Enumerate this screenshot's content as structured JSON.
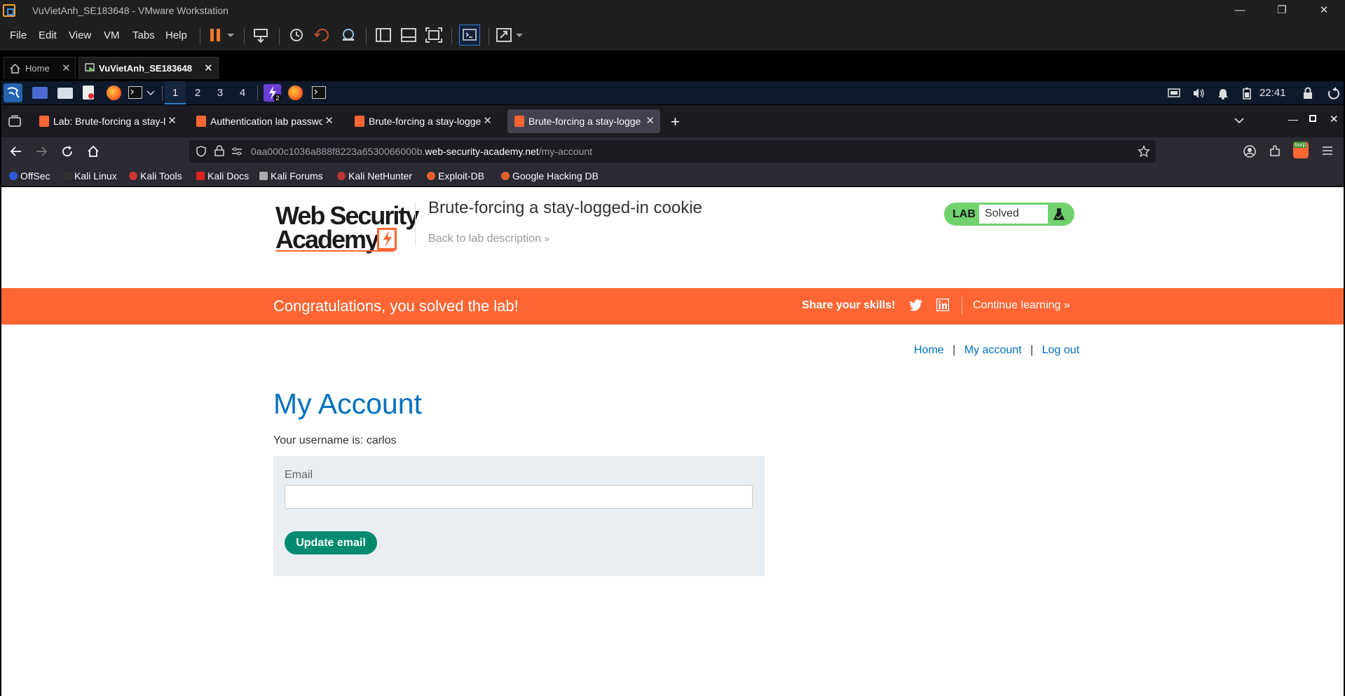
{
  "vmware": {
    "window_title": "VuVietAnh_SE183648 - VMware Workstation",
    "menu": [
      "File",
      "Edit",
      "View",
      "VM",
      "Tabs",
      "Help"
    ],
    "tabs": [
      {
        "label": "Home"
      },
      {
        "label": "VuVietAnh_SE183648"
      }
    ]
  },
  "kali_panel": {
    "workspaces": [
      "1",
      "2",
      "3",
      "4"
    ],
    "notification_count": "2",
    "clock": "22:41"
  },
  "firefox": {
    "tabs": [
      {
        "label": "Lab: Brute-forcing a stay-lo"
      },
      {
        "label": "Authentication lab passwo"
      },
      {
        "label": "Brute-forcing a stay-logge"
      },
      {
        "label": "Brute-forcing a stay-logge"
      }
    ],
    "url": {
      "prefix": "0aa000c1036a888f8223a6530066000b.",
      "domain": "web-security-academy.net",
      "path": "/my-account"
    },
    "bookmarks": [
      "OffSec",
      "Kali Linux",
      "Kali Tools",
      "Kali Docs",
      "Kali Forums",
      "Kali NetHunter",
      "Exploit-DB",
      "Google Hacking DB"
    ],
    "burp_icon_label": "burp"
  },
  "page": {
    "logo_line1": "Web Security",
    "logo_line2": "Academy",
    "lab_title": "Brute-forcing a stay-logged-in cookie",
    "back_link": "Back to lab description",
    "lab_badge": {
      "lab": "LAB",
      "status": "Solved"
    },
    "banner": {
      "message": "Congratulations, you solved the lab!",
      "share": "Share your skills!",
      "continue": "Continue learning"
    },
    "nav": {
      "home": "Home",
      "sep": "|",
      "account": "My account",
      "logout": "Log out"
    },
    "heading": "My Account",
    "username_text": "Your username is: carlos",
    "email_label": "Email",
    "email_value": "",
    "update_button": "Update email"
  },
  "colors": {
    "portswigger_orange": "#ff6633",
    "link_blue": "#0071bc",
    "solved_green": "#70d16d",
    "button_green": "#008b6e"
  }
}
